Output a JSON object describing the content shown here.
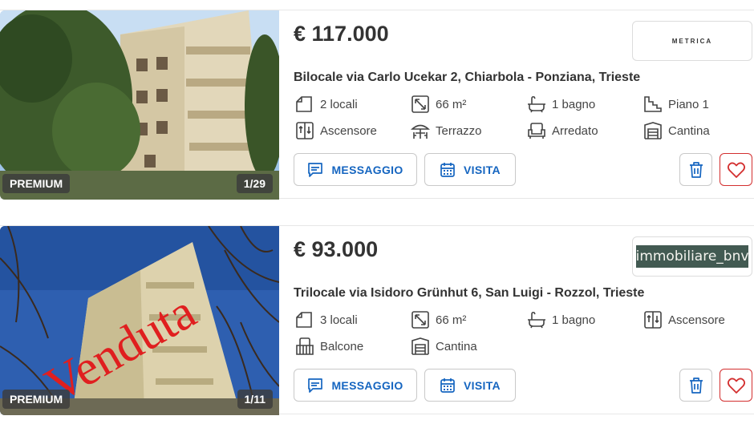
{
  "listings": [
    {
      "price": "€ 117.000",
      "title": "Bilocale via Carlo Ucekar 2, Chiarbola - Ponziana, Trieste",
      "badge": "PREMIUM",
      "photo_counter": "1/29",
      "agency_logo_text": "METRICA",
      "features": [
        "2 locali",
        "66 m²",
        "1 bagno",
        "Piano 1",
        "Ascensore",
        "Terrazzo",
        "Arredato",
        "Cantina"
      ],
      "buttons": {
        "message": "MESSAGGIO",
        "visit": "VISITA"
      }
    },
    {
      "price": "€ 93.000",
      "title": "Trilocale via Isidoro Grünhut 6, San Luigi - Rozzol, Trieste",
      "badge": "PREMIUM",
      "photo_counter": "1/11",
      "photo_overlay_text": "Venduta",
      "agency_logo_text": "immobiliare_bnv",
      "features": [
        "3 locali",
        "66 m²",
        "1 bagno",
        "Ascensore",
        "Balcone",
        "Cantina"
      ],
      "buttons": {
        "message": "MESSAGGIO",
        "visit": "VISITA"
      }
    }
  ],
  "colors": {
    "accent": "#1565c0",
    "favorite": "#d32f2f",
    "text": "#333333"
  }
}
